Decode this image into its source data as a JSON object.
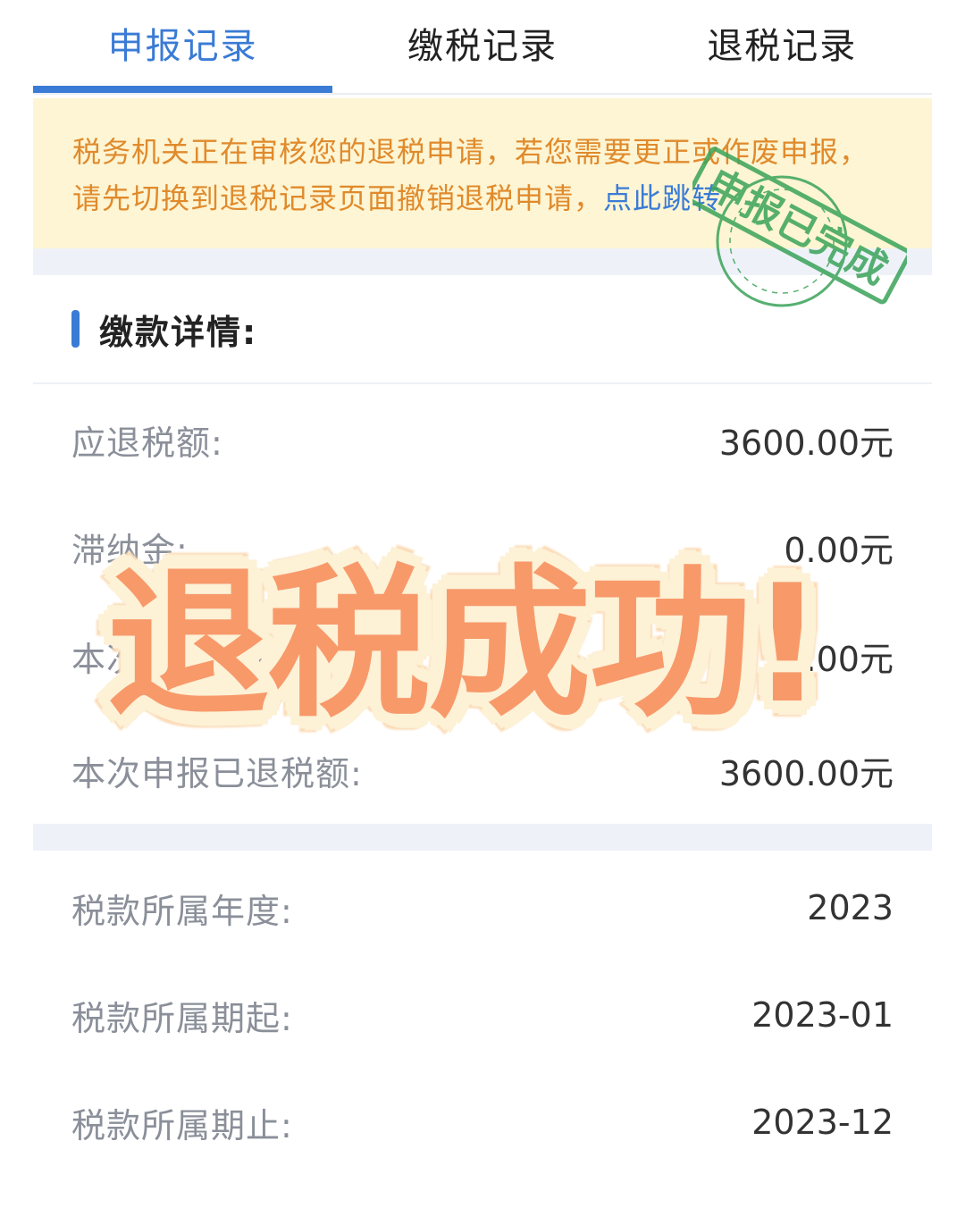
{
  "tabs": [
    {
      "label": "申报记录",
      "active": true
    },
    {
      "label": "缴税记录",
      "active": false
    },
    {
      "label": "退税记录",
      "active": false
    }
  ],
  "notice": {
    "text": "税务机关正在审核您的退税申请，若您需要更正或作废申报，请先切换到退税记录页面撤销退税申请",
    "link": "点此跳转"
  },
  "stamp": {
    "text": "申报已完成",
    "color": "#3aa35a"
  },
  "section": {
    "title": "缴款详情:"
  },
  "details": [
    {
      "label": "应退税额:",
      "value": "3600.00元"
    },
    {
      "label": "滞纳金:",
      "value": "0.00元"
    },
    {
      "label": "本次申报应退税额:",
      "value": "0.00元"
    },
    {
      "label": "本次申报已退税额:",
      "value": "3600.00元"
    }
  ],
  "period": [
    {
      "label": "税款所属年度:",
      "value": "2023"
    },
    {
      "label": "税款所属期起:",
      "value": "2023-01"
    },
    {
      "label": "税款所属期止:",
      "value": "2023-12"
    }
  ],
  "overlay": {
    "text": "退税成功!"
  },
  "colors": {
    "accent": "#3a7bd5",
    "notice_text": "#e08a2c",
    "notice_bg": "#fdf5d3",
    "overlay_text": "#f8996a"
  }
}
